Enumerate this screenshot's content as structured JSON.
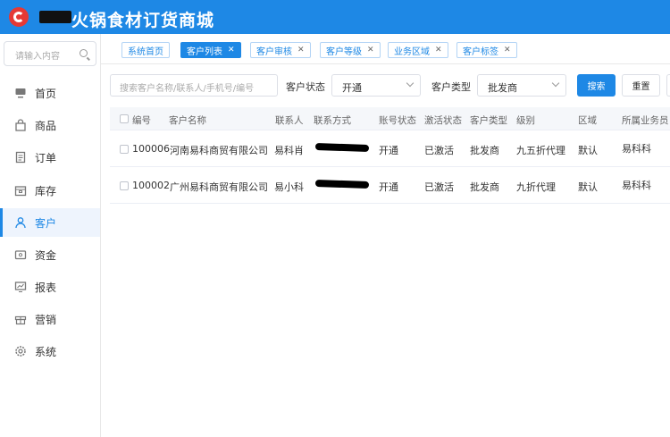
{
  "header": {
    "title": "火锅食材订货商城"
  },
  "sidebar": {
    "search_placeholder": "请输入内容",
    "items": [
      {
        "label": "首页",
        "icon": "monitor-icon"
      },
      {
        "label": "商品",
        "icon": "shopping-bag-icon"
      },
      {
        "label": "订单",
        "icon": "document-icon"
      },
      {
        "label": "库存",
        "icon": "warehouse-icon"
      },
      {
        "label": "客户",
        "icon": "user-icon",
        "active": true
      },
      {
        "label": "资金",
        "icon": "wallet-icon"
      },
      {
        "label": "报表",
        "icon": "chart-icon"
      },
      {
        "label": "营销",
        "icon": "gift-icon"
      },
      {
        "label": "系统",
        "icon": "gear-icon"
      }
    ]
  },
  "tabs": [
    {
      "label": "系统首页",
      "closable": false
    },
    {
      "label": "客户列表",
      "closable": true,
      "active": true
    },
    {
      "label": "客户审核",
      "closable": true
    },
    {
      "label": "客户等级",
      "closable": true
    },
    {
      "label": "业务区域",
      "closable": true
    },
    {
      "label": "客户标签",
      "closable": true
    }
  ],
  "filters": {
    "search_placeholder": "搜索客户名称/联系人/手机号/编号",
    "status_label": "客户状态",
    "status_value": "开通",
    "type_label": "客户类型",
    "type_value": "批发商",
    "search_button": "搜索",
    "reset_button": "重置"
  },
  "table": {
    "columns": [
      "编号",
      "客户名称",
      "联系人",
      "联系方式",
      "账号状态",
      "激活状态",
      "客户类型",
      "级别",
      "区域",
      "所属业务员"
    ],
    "rows": [
      {
        "id": "100006",
        "name": "河南易科商贸有限公司",
        "contact": "易科肖",
        "phone": "[redacted]",
        "account_status": "开通",
        "activation": "已激活",
        "type": "批发商",
        "level": "九五折代理",
        "region": "默认",
        "salesperson": "易科科"
      },
      {
        "id": "100002",
        "name": "广州易科商贸有限公司",
        "contact": "易小科",
        "phone": "[redacted]",
        "account_status": "开通",
        "activation": "已激活",
        "type": "批发商",
        "level": "九折代理",
        "region": "默认",
        "salesperson": "易科科"
      }
    ]
  },
  "colors": {
    "primary": "#1e88e5",
    "logo": "#e53935"
  }
}
